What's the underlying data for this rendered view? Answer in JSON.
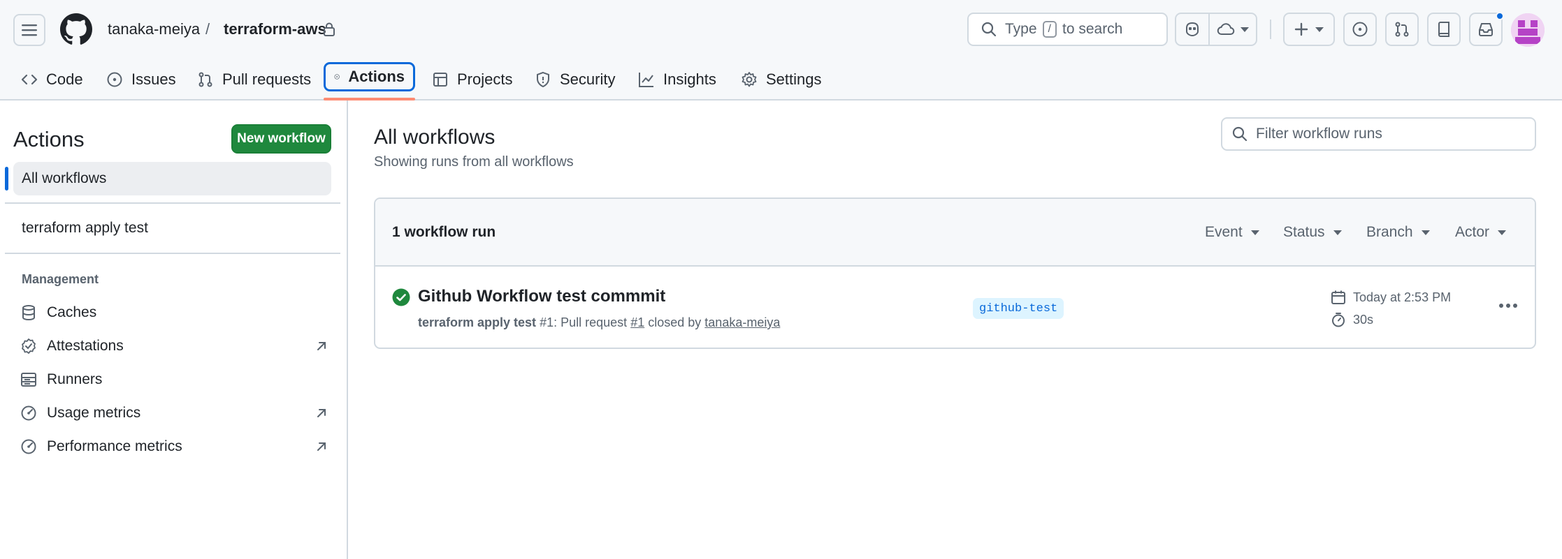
{
  "header": {
    "owner": "tanaka-meiya",
    "separator": "/",
    "repo": "terraform-aws",
    "search": {
      "prefix": "Type",
      "key": "/",
      "suffix": "to search"
    }
  },
  "tabs": [
    {
      "label": "Code",
      "icon": "code-icon"
    },
    {
      "label": "Issues",
      "icon": "issue-icon"
    },
    {
      "label": "Pull requests",
      "icon": "pull-request-icon"
    },
    {
      "label": "Actions",
      "icon": "play-icon",
      "active": true
    },
    {
      "label": "Projects",
      "icon": "table-icon"
    },
    {
      "label": "Security",
      "icon": "shield-icon"
    },
    {
      "label": "Insights",
      "icon": "graph-icon"
    },
    {
      "label": "Settings",
      "icon": "gear-icon"
    }
  ],
  "sidebar": {
    "title": "Actions",
    "new_workflow": "New workflow",
    "all_workflows": "All workflows",
    "workflows": [
      "terraform apply test"
    ],
    "section": "Management",
    "items": [
      {
        "label": "Caches",
        "icon": "database-icon",
        "external": false
      },
      {
        "label": "Attestations",
        "icon": "verified-icon",
        "external": true
      },
      {
        "label": "Runners",
        "icon": "server-icon",
        "external": false
      },
      {
        "label": "Usage metrics",
        "icon": "meter-icon",
        "external": true
      },
      {
        "label": "Performance metrics",
        "icon": "meter-icon",
        "external": true
      }
    ]
  },
  "main": {
    "title": "All workflows",
    "subtitle": "Showing runs from all workflows",
    "filter_placeholder": "Filter workflow runs",
    "runs_count": "1 workflow run",
    "filters": [
      "Event",
      "Status",
      "Branch",
      "Actor"
    ],
    "run": {
      "title": "Github Workflow test commmit",
      "workflow": "terraform apply test",
      "number": "#1",
      "meta_middle": ": Pull request",
      "pr": "#1",
      "meta_closed": "closed by",
      "user": "tanaka-meiya",
      "branch": "github-test",
      "date": "Today at 2:53 PM",
      "duration": "30s",
      "status": "success"
    }
  },
  "colors": {
    "accent": "#0969da",
    "success": "#1f883d",
    "tab_underline": "#fd8c73"
  }
}
